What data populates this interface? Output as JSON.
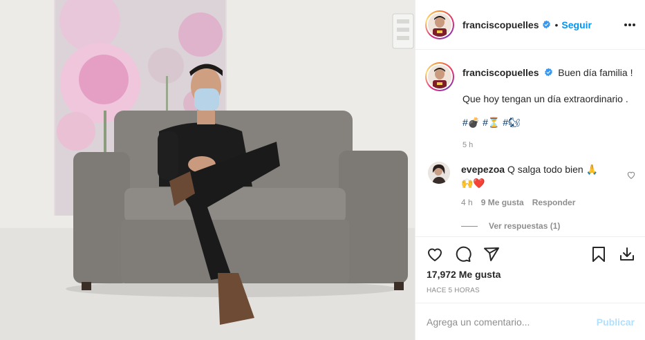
{
  "post": {
    "author": "franciscopuelles",
    "follow_separator": "•",
    "follow_label": "Seguir",
    "caption": {
      "line1_text": "Buen día familia !",
      "line2_text": "Que hoy tengan un día extraordinario .",
      "hashtags": "#💣 #⏳ #🐿",
      "time": "5 h"
    },
    "comments": [
      {
        "username": "evepezoa",
        "text": "Q salga todo bien 🙏",
        "emoji_line": "🙌❤️",
        "time": "4 h",
        "likes": "9 Me gusta",
        "reply_label": "Responder"
      }
    ],
    "view_replies": "Ver respuestas (1)",
    "likes_count": "17,972 Me gusta",
    "posted_ago": "HACE 5 HORAS",
    "comment_placeholder": "Agrega un comentario...",
    "publish_label": "Publicar"
  },
  "colors": {
    "accent": "#0095f6",
    "verified": "#3897f0",
    "muted": "#8e8e8e",
    "publish_disabled": "#b2dffc"
  },
  "icons": {
    "more": "more-horizontal-icon",
    "verified": "verified-badge-icon",
    "like": "heart-icon",
    "comment": "comment-bubble-icon",
    "share": "paper-plane-icon",
    "save": "bookmark-icon",
    "download": "download-icon"
  }
}
